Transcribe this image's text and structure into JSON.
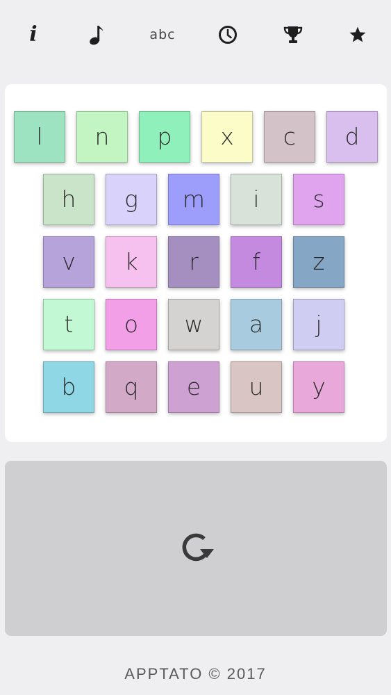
{
  "toolbar": {
    "info_icon": "info-icon",
    "info_glyph": "i",
    "music_icon": "music-note-icon",
    "abc_label": "abc",
    "timer_icon": "clock-icon",
    "trophy_icon": "trophy-icon",
    "star_icon": "star-icon"
  },
  "board": {
    "rows": [
      [
        {
          "letter": "l",
          "color": "#9ee3c1"
        },
        {
          "letter": "n",
          "color": "#c2f5c2"
        },
        {
          "letter": "p",
          "color": "#8ff0bb"
        },
        {
          "letter": "x",
          "color": "#fbfcc8"
        },
        {
          "letter": "c",
          "color": "#d3c3c9"
        },
        {
          "letter": "d",
          "color": "#d9bfee"
        }
      ],
      [
        {
          "letter": "h",
          "color": "#c9e4c9"
        },
        {
          "letter": "g",
          "color": "#d9d3fb"
        },
        {
          "letter": "m",
          "color": "#9d9efc"
        },
        {
          "letter": "i",
          "color": "#d9e2d9"
        },
        {
          "letter": "s",
          "color": "#e0a3ee"
        }
      ],
      [
        {
          "letter": "v",
          "color": "#b5a3da"
        },
        {
          "letter": "k",
          "color": "#f6c1ee"
        },
        {
          "letter": "r",
          "color": "#a58fc0"
        },
        {
          "letter": "f",
          "color": "#c38adf"
        },
        {
          "letter": "z",
          "color": "#86a6c6"
        }
      ],
      [
        {
          "letter": "t",
          "color": "#c3f8d5"
        },
        {
          "letter": "o",
          "color": "#f29fe8"
        },
        {
          "letter": "w",
          "color": "#d5d3d1"
        },
        {
          "letter": "a",
          "color": "#a8cbdf"
        },
        {
          "letter": "j",
          "color": "#cfcdf1"
        }
      ],
      [
        {
          "letter": "b",
          "color": "#8fd7e4"
        },
        {
          "letter": "q",
          "color": "#d2a9c7"
        },
        {
          "letter": "e",
          "color": "#cda2d2"
        },
        {
          "letter": "u",
          "color": "#dac5c5"
        },
        {
          "letter": "y",
          "color": "#e8a9da"
        }
      ]
    ]
  },
  "action": {
    "icon": "refresh-icon"
  },
  "footer": {
    "copyright": "APPTATO © 2017"
  }
}
